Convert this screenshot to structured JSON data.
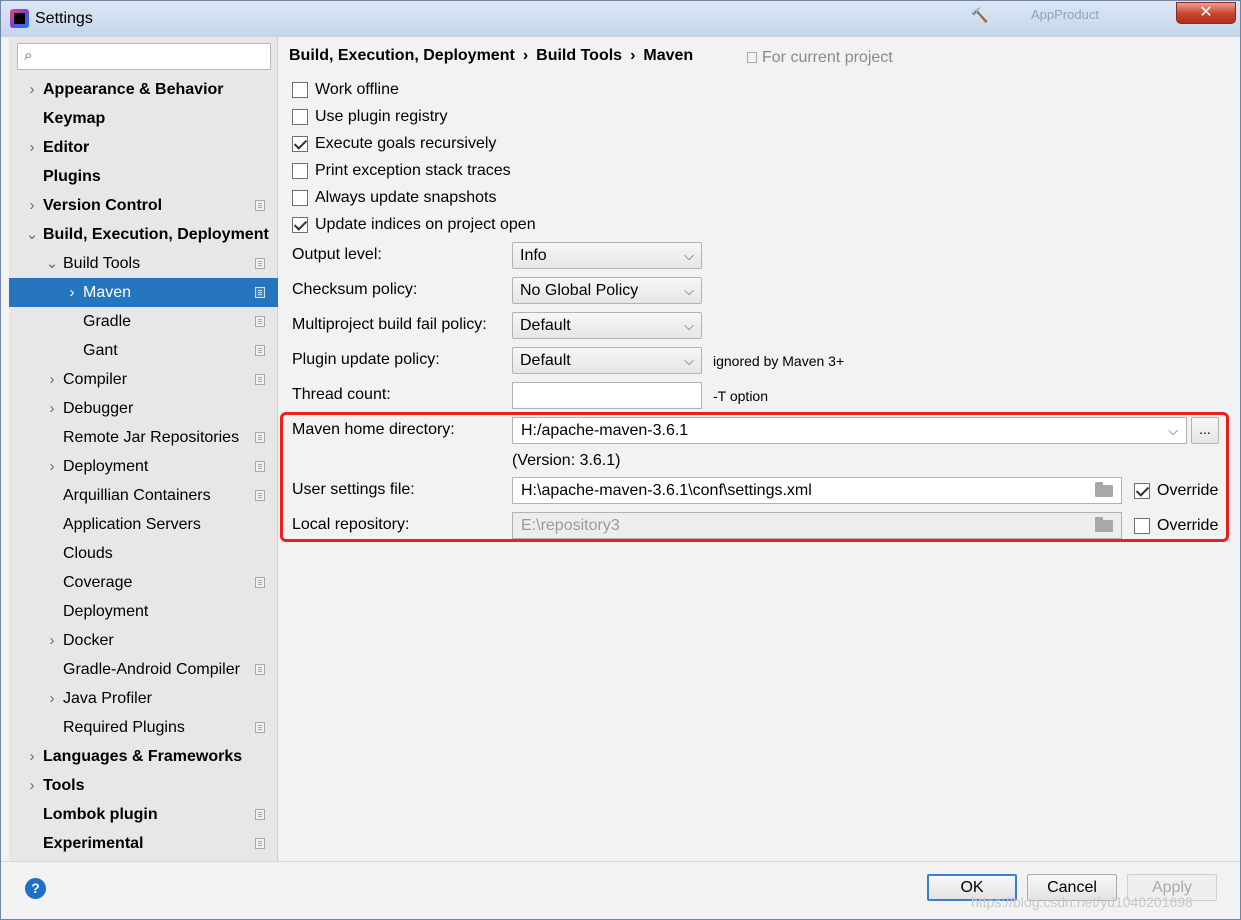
{
  "window": {
    "title": "Settings",
    "background_title": "AppProduct",
    "close_label": "✕"
  },
  "sidebar": {
    "search": {
      "placeholder": "",
      "value": ""
    },
    "items": [
      {
        "label": "Appearance & Behavior",
        "level": 0,
        "bold": true,
        "arrow": "›",
        "project": false
      },
      {
        "label": "Keymap",
        "level": 0,
        "bold": true,
        "arrow": "",
        "project": false
      },
      {
        "label": "Editor",
        "level": 0,
        "bold": true,
        "arrow": "›",
        "project": false
      },
      {
        "label": "Plugins",
        "level": 0,
        "bold": true,
        "arrow": "",
        "project": false
      },
      {
        "label": "Version Control",
        "level": 0,
        "bold": true,
        "arrow": "›",
        "project": true
      },
      {
        "label": "Build, Execution, Deployment",
        "level": 0,
        "bold": true,
        "arrow": "⌄",
        "project": false
      },
      {
        "label": "Build Tools",
        "level": 1,
        "bold": false,
        "arrow": "⌄",
        "project": true
      },
      {
        "label": "Maven",
        "level": 2,
        "bold": false,
        "arrow": "›",
        "project": true,
        "selected": true
      },
      {
        "label": "Gradle",
        "level": 2,
        "bold": false,
        "arrow": "",
        "project": true
      },
      {
        "label": "Gant",
        "level": 2,
        "bold": false,
        "arrow": "",
        "project": true
      },
      {
        "label": "Compiler",
        "level": 1,
        "bold": false,
        "arrow": "›",
        "project": true
      },
      {
        "label": "Debugger",
        "level": 1,
        "bold": false,
        "arrow": "›",
        "project": false
      },
      {
        "label": "Remote Jar Repositories",
        "level": 1,
        "bold": false,
        "arrow": "",
        "project": true
      },
      {
        "label": "Deployment",
        "level": 1,
        "bold": false,
        "arrow": "›",
        "project": true
      },
      {
        "label": "Arquillian Containers",
        "level": 1,
        "bold": false,
        "arrow": "",
        "project": true
      },
      {
        "label": "Application Servers",
        "level": 1,
        "bold": false,
        "arrow": "",
        "project": false
      },
      {
        "label": "Clouds",
        "level": 1,
        "bold": false,
        "arrow": "",
        "project": false
      },
      {
        "label": "Coverage",
        "level": 1,
        "bold": false,
        "arrow": "",
        "project": true
      },
      {
        "label": "Deployment",
        "level": 1,
        "bold": false,
        "arrow": "",
        "project": false
      },
      {
        "label": "Docker",
        "level": 1,
        "bold": false,
        "arrow": "›",
        "project": false
      },
      {
        "label": "Gradle-Android Compiler",
        "level": 1,
        "bold": false,
        "arrow": "",
        "project": true
      },
      {
        "label": "Java Profiler",
        "level": 1,
        "bold": false,
        "arrow": "›",
        "project": false
      },
      {
        "label": "Required Plugins",
        "level": 1,
        "bold": false,
        "arrow": "",
        "project": true
      },
      {
        "label": "Languages & Frameworks",
        "level": 0,
        "bold": true,
        "arrow": "›",
        "project": false
      },
      {
        "label": "Tools",
        "level": 0,
        "bold": true,
        "arrow": "›",
        "project": false
      },
      {
        "label": "Lombok plugin",
        "level": 0,
        "bold": true,
        "arrow": "",
        "project": true
      },
      {
        "label": "Experimental",
        "level": 0,
        "bold": true,
        "arrow": "",
        "project": true
      }
    ]
  },
  "breadcrumb": {
    "parts": [
      "Build, Execution, Deployment",
      "Build Tools",
      "Maven"
    ],
    "separator": "›",
    "scope_label": "For current project"
  },
  "checkboxes": [
    {
      "label": "Work offline",
      "checked": false
    },
    {
      "label": "Use plugin registry",
      "checked": false
    },
    {
      "label": "Execute goals recursively",
      "checked": true
    },
    {
      "label": "Print exception stack traces",
      "checked": false
    },
    {
      "label": "Always update snapshots",
      "checked": false
    },
    {
      "label": "Update indices on project open",
      "checked": true
    }
  ],
  "form": {
    "output_level": {
      "label": "Output level:",
      "value": "Info"
    },
    "checksum_policy": {
      "label": "Checksum policy:",
      "value": "No Global Policy"
    },
    "fail_policy": {
      "label": "Multiproject build fail policy:",
      "value": "Default"
    },
    "plugin_update_policy": {
      "label": "Plugin update policy:",
      "value": "Default",
      "hint": "ignored by Maven 3+"
    },
    "thread_count": {
      "label": "Thread count:",
      "value": "",
      "hint": "-T option"
    },
    "maven_home": {
      "label": "Maven home directory:",
      "value": "H:/apache-maven-3.6.1",
      "version": "(Version: 3.6.1)",
      "browse_label": "..."
    },
    "user_settings": {
      "label": "User settings file:",
      "value": "H:\\apache-maven-3.6.1\\conf\\settings.xml",
      "override_label": "Override",
      "override": true
    },
    "local_repo": {
      "label": "Local repository:",
      "value": "E:\\repository3",
      "override_label": "Override",
      "override": false
    }
  },
  "footer": {
    "help_label": "?",
    "ok_label": "OK",
    "cancel_label": "Cancel",
    "apply_label": "Apply",
    "watermark": "https://blog.csdn.net/yd1040201698"
  },
  "colors": {
    "selection": "#2675bf",
    "highlight_border": "#e8211e",
    "help": "#1e6fc5"
  }
}
